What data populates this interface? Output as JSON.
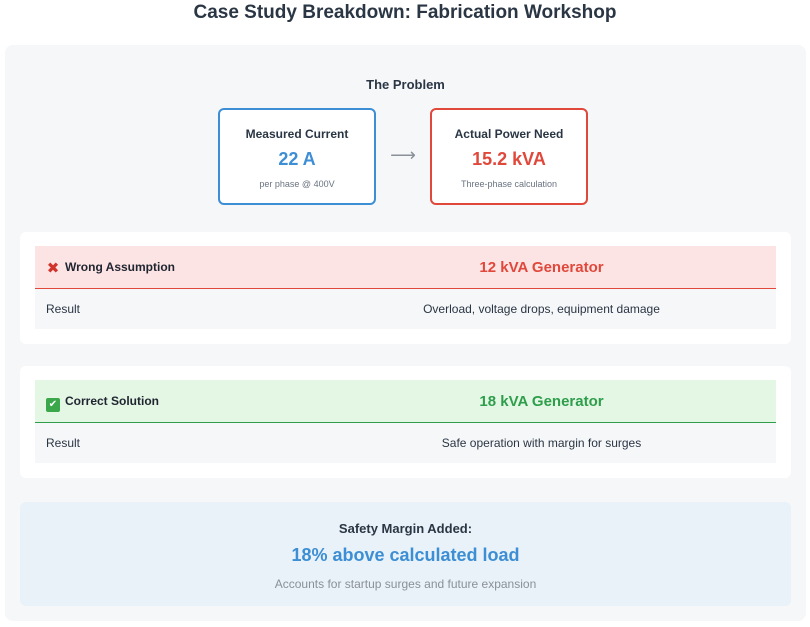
{
  "page": {
    "title": "Case Study Breakdown: Fabrication Workshop"
  },
  "problem": {
    "title": "The Problem",
    "measured": {
      "label": "Measured Current",
      "value": "22 A",
      "sub": "per phase @ 400V"
    },
    "arrow": "⟶",
    "actual": {
      "label": "Actual Power Need",
      "value": "15.2 kVA",
      "sub": "Three-phase calculation"
    }
  },
  "wrong": {
    "icon": "cross-mark-icon",
    "icon_glyph": "✖",
    "label": "Wrong Assumption",
    "value": "12 kVA Generator",
    "row_label": "Result",
    "row_value": "Overload, voltage drops, equipment damage"
  },
  "correct": {
    "icon": "check-mark-icon",
    "icon_glyph": "✔",
    "label": "Correct Solution",
    "value": "18 kVA Generator",
    "row_label": "Result",
    "row_value": "Safe operation with margin for surges"
  },
  "safety": {
    "title": "Safety Margin Added:",
    "value": "18% above calculated load",
    "sub": "Accounts for startup surges and future expansion"
  },
  "colors": {
    "blue": "#3d8ed4",
    "red": "#e0483b",
    "green": "#2e9e4b"
  }
}
